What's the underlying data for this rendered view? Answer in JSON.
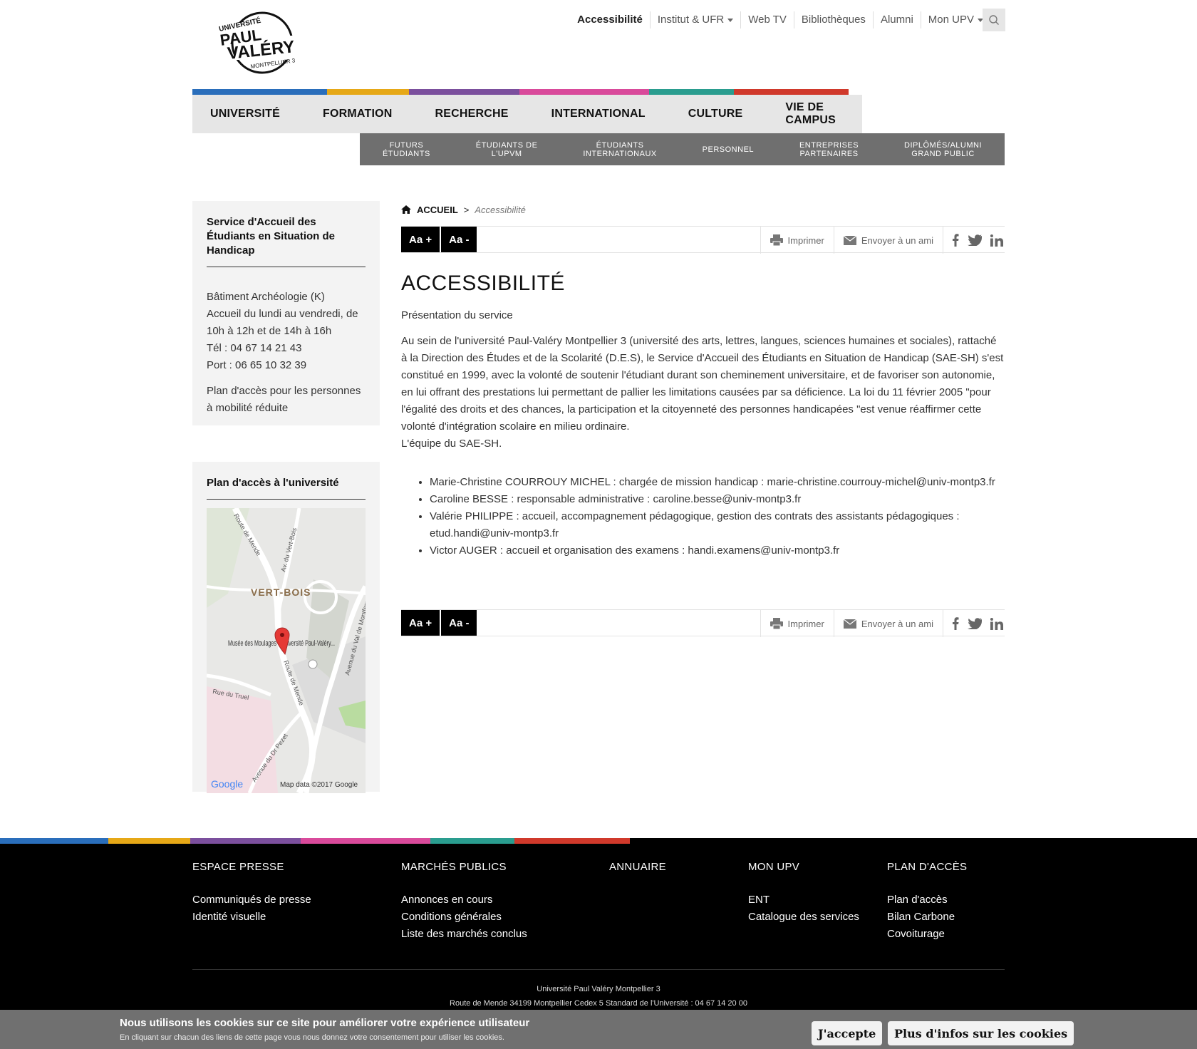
{
  "header": {
    "logo_text": [
      "UNIVERSITÉ",
      "PAUL",
      "VALÉRY",
      "MONTPELLIER 3"
    ],
    "top_links": [
      "Accessibilité",
      "Institut & UFR",
      "Web TV",
      "Bibliothèques",
      "Alumni",
      "Mon UPV"
    ],
    "search_icon": "search-icon"
  },
  "colors": {
    "blue": "#2a6ebb",
    "yellow": "#e6a817",
    "purple": "#7b4f9d",
    "pink": "#d94a9b",
    "teal": "#2a9d8f",
    "red": "#d0392b"
  },
  "main_nav": [
    "UNIVERSITÉ",
    "FORMATION",
    "RECHERCHE",
    "INTERNATIONAL",
    "CULTURE",
    "VIE DE CAMPUS"
  ],
  "sub_nav": [
    "FUTURS\nÉTUDIANTS",
    "ÉTUDIANTS DE\nL'UPVM",
    "ÉTUDIANTS\nINTERNATIONAUX",
    "PERSONNEL",
    "ENTREPRISES\nPARTENAIRES",
    "DIPLÔMÉS/ALUMNI\nGRAND PUBLIC"
  ],
  "sidebar": {
    "service_title": "Service d'Accueil des Étudiants en Situation de Handicap",
    "address_lines": [
      "Bâtiment Archéologie (K)",
      "Accueil du lundi au vendredi, de 10h à 12h et de 14h à 16h",
      "Tél : 04 67 14 21 43",
      "Port : 06 65 10 32 39"
    ],
    "access_plan": "Plan d'accès pour les personnes à mobilité réduite",
    "map_title": "Plan d'accès à l'université",
    "map": {
      "area": "VERT-BOIS",
      "place": "Musée des Moulages - Université Paul-Valéry...",
      "streets": [
        "Route de Mende",
        "Av. du Vert-Bois",
        "Avenue du Val de Montferrand",
        "Rue du Truel",
        "Avenue du Dr Pezet"
      ],
      "logo": "Google",
      "credit": "Map data ©2017 Google"
    }
  },
  "breadcrumb": {
    "home": "ACCUEIL",
    "separator": ">",
    "current": "Accessibilité"
  },
  "tools": {
    "font_increase": "Aa +",
    "font_decrease": "Aa -",
    "print": "Imprimer",
    "send": "Envoyer à un ami"
  },
  "page": {
    "title": "ACCESSIBILITÉ",
    "intro": "Présentation du service",
    "body": "Au sein de l'université Paul-Valéry Montpellier 3 (université des arts, lettres, langues, sciences humaines et sociales), rattaché à la Direction des Études et de la Scolarité (D.E.S), le Service d'Accueil des Étudiants en Situation de Handicap (SAE-SH) s'est constitué en 1999, avec la volonté de soutenir l'étudiant durant son cheminement universitaire, et de favoriser son autonomie, en lui offrant des prestations lui permettant de pallier les limitations causées par sa déficience. La loi du 11 février 2005 \"pour l'égalité des droits et des chances, la participation et la citoyenneté des personnes handicapées \"est venue réaffirmer cette volonté d'intégration scolaire en milieu ordinaire.",
    "team": "L'équipe du SAE-SH.",
    "staff": [
      "Marie-Christine COURROUY MICHEL : chargée de mission handicap :  marie-christine.courrouy-michel@univ-montp3.fr",
      "Caroline BESSE : responsable administrative : caroline.besse@univ-montp3.fr",
      "Valérie PHILIPPE : accueil, accompagnement pédagogique, gestion des contrats des assistants pédagogiques : etud.handi@univ-montp3.fr",
      "Victor AUGER : accueil et organisation des examens : handi.examens@univ-montp3.fr"
    ]
  },
  "footer": {
    "columns": [
      {
        "heading": "ESPACE PRESSE",
        "links": [
          "Communiqués de presse",
          "Identité visuelle"
        ]
      },
      {
        "heading": "MARCHÉS PUBLICS",
        "links": [
          "Annonces en cours",
          "Conditions générales",
          "Liste des marchés conclus"
        ]
      },
      {
        "heading": "ANNUAIRE",
        "links": []
      },
      {
        "heading": "MON UPV",
        "links": [
          "ENT",
          "Catalogue des services"
        ]
      },
      {
        "heading": "PLAN D'ACCÈS",
        "links": [
          "Plan d'accès",
          "Bilan Carbone",
          "Covoiturage"
        ]
      }
    ],
    "address1": "Université Paul Valéry Montpellier 3",
    "address2": "Route de Mende 34199 Montpellier Cedex 5 Standard de l'Université : 04 67 14 20 00"
  },
  "cookie": {
    "title": "Nous utilisons les cookies sur ce site pour améliorer votre expérience utilisateur",
    "subtitle": "En cliquant sur chacun des liens de cette page vous nous donnez votre consentement pour utiliser les cookies.",
    "accept": "J'accepte",
    "more": "Plus d'infos sur les cookies"
  }
}
